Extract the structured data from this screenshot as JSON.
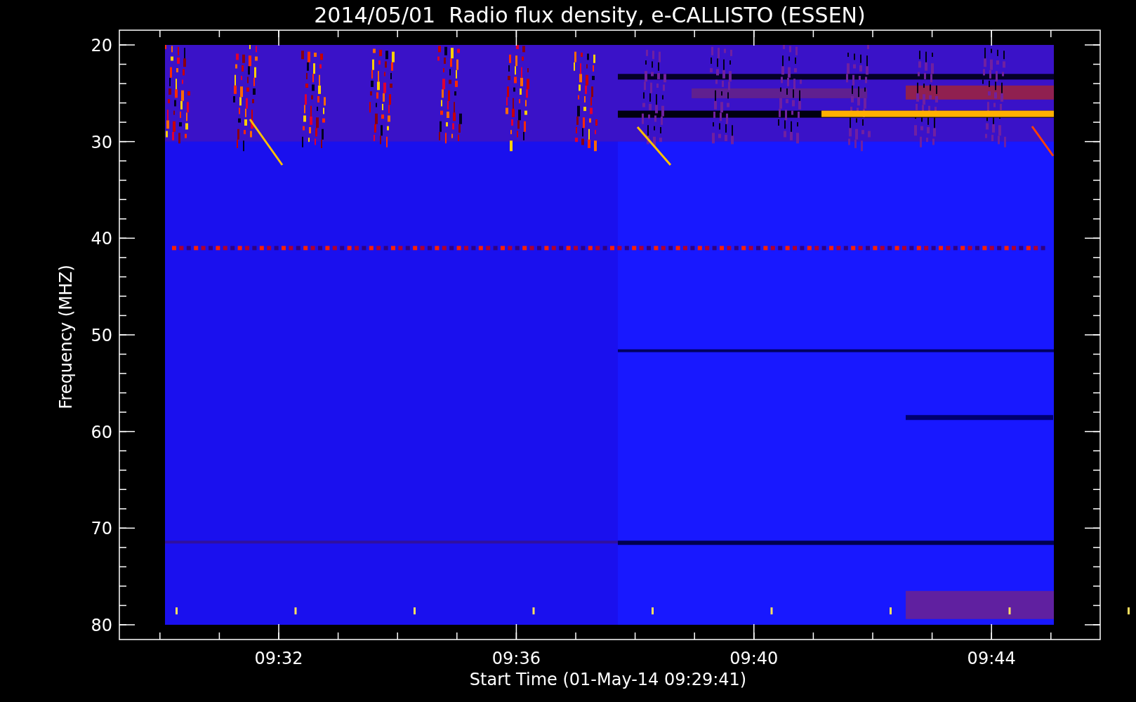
{
  "title": "2014/05/01  Radio flux density, e-CALLISTO (ESSEN)",
  "ylabel": "Frequency (MHZ)",
  "xlabel": "Start Time (01-May-14 09:29:41)",
  "yticks": [
    "20",
    "30",
    "40",
    "50",
    "60",
    "70",
    "80"
  ],
  "xticks": [
    "09:32",
    "09:36",
    "09:40",
    "09:44"
  ]
}
